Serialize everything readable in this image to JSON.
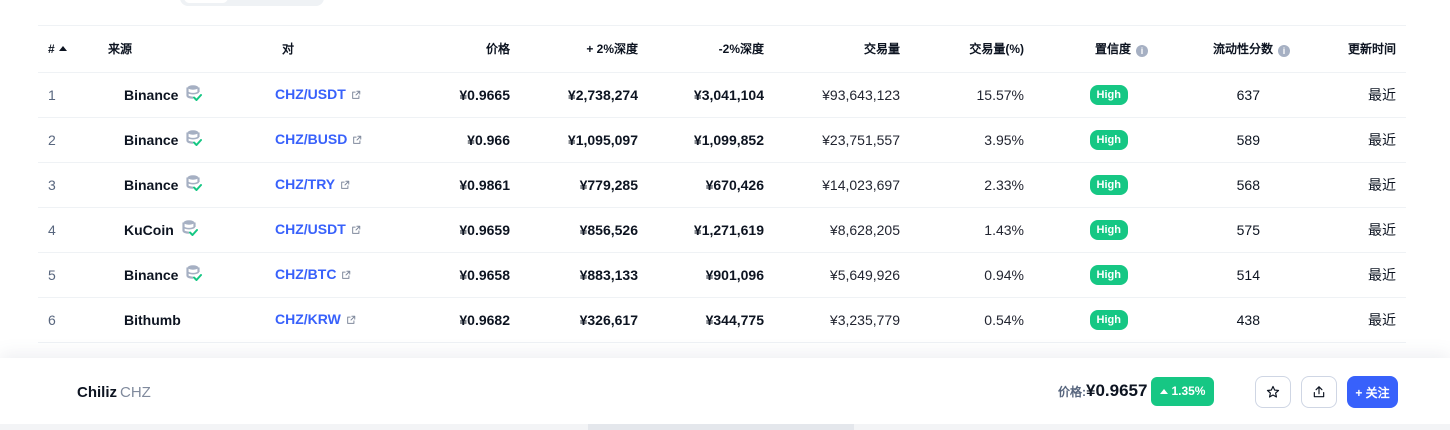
{
  "columns": {
    "rank": "#",
    "source": "来源",
    "pair": "对",
    "price": "价格",
    "depth_plus": "+ 2%深度",
    "depth_minus": "-2%深度",
    "volume": "交易量",
    "volume_pct": "交易量(%)",
    "confidence": "置信度",
    "liquidity": "流动性分数",
    "updated": "更新时间"
  },
  "rows": [
    {
      "rank": "1",
      "exchange": "Binance",
      "verified": true,
      "pair": "CHZ/USDT",
      "price": "¥0.9665",
      "depth_plus": "¥2,738,274",
      "depth_minus": "¥3,041,104",
      "volume": "¥93,643,123",
      "volume_pct": "15.57%",
      "confidence": "High",
      "liquidity": "637",
      "updated": "最近"
    },
    {
      "rank": "2",
      "exchange": "Binance",
      "verified": true,
      "pair": "CHZ/BUSD",
      "price": "¥0.966",
      "depth_plus": "¥1,095,097",
      "depth_minus": "¥1,099,852",
      "volume": "¥23,751,557",
      "volume_pct": "3.95%",
      "confidence": "High",
      "liquidity": "589",
      "updated": "最近"
    },
    {
      "rank": "3",
      "exchange": "Binance",
      "verified": true,
      "pair": "CHZ/TRY",
      "price": "¥0.9861",
      "depth_plus": "¥779,285",
      "depth_minus": "¥670,426",
      "volume": "¥14,023,697",
      "volume_pct": "2.33%",
      "confidence": "High",
      "liquidity": "568",
      "updated": "最近"
    },
    {
      "rank": "4",
      "exchange": "KuCoin",
      "verified": true,
      "pair": "CHZ/USDT",
      "price": "¥0.9659",
      "depth_plus": "¥856,526",
      "depth_minus": "¥1,271,619",
      "volume": "¥8,628,205",
      "volume_pct": "1.43%",
      "confidence": "High",
      "liquidity": "575",
      "updated": "最近"
    },
    {
      "rank": "5",
      "exchange": "Binance",
      "verified": true,
      "pair": "CHZ/BTC",
      "price": "¥0.9658",
      "depth_plus": "¥883,133",
      "depth_minus": "¥901,096",
      "volume": "¥5,649,926",
      "volume_pct": "0.94%",
      "confidence": "High",
      "liquidity": "514",
      "updated": "最近"
    },
    {
      "rank": "6",
      "exchange": "Bithumb",
      "verified": false,
      "pair": "CHZ/KRW",
      "price": "¥0.9682",
      "depth_plus": "¥326,617",
      "depth_minus": "¥344,775",
      "volume": "¥3,235,779",
      "volume_pct": "0.54%",
      "confidence": "High",
      "liquidity": "438",
      "updated": "最近"
    }
  ],
  "footer": {
    "coin_name": "Chiliz",
    "coin_symbol": "CHZ",
    "price_label": "价格:",
    "price": "¥0.9657",
    "change": "1.35%",
    "follow_label": "+ 关注"
  },
  "icons": {
    "info": "i",
    "verified": "database-check-icon",
    "external": "external-link-icon",
    "star": "star-icon",
    "share": "share-icon"
  },
  "colors": {
    "accent": "#3861fb",
    "positive": "#16c784",
    "muted": "#58667e"
  }
}
